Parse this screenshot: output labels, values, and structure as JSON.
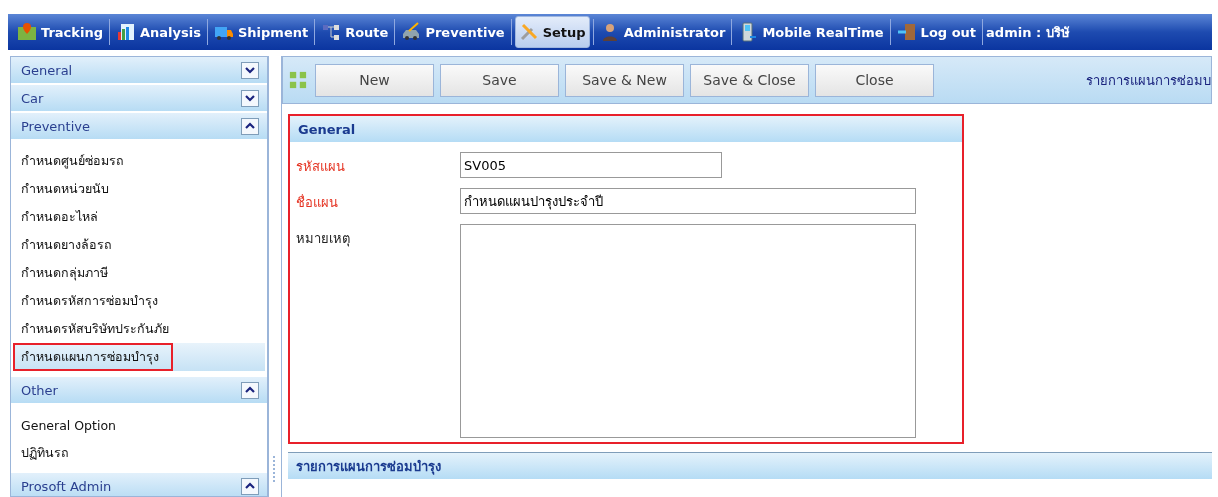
{
  "menu": [
    {
      "label": "Tracking",
      "selected": false
    },
    {
      "label": "Analysis",
      "selected": false
    },
    {
      "label": "Shipment",
      "selected": false
    },
    {
      "label": "Route",
      "selected": false
    },
    {
      "label": "Preventive",
      "selected": false
    },
    {
      "label": "Setup",
      "selected": true
    },
    {
      "label": "Administrator",
      "selected": false
    },
    {
      "label": "Mobile RealTime",
      "selected": false
    },
    {
      "label": "Log out",
      "selected": false
    }
  ],
  "user": "admin : บริษั",
  "sidebar": [
    {
      "title": "General",
      "expanded": false
    },
    {
      "title": "Car",
      "expanded": false
    },
    {
      "title": "Preventive",
      "expanded": true,
      "items": [
        {
          "label": "กำหนดศูนย์ซ่อมรถ",
          "selected": false
        },
        {
          "label": "กำหนดหน่วยนับ",
          "selected": false
        },
        {
          "label": "กำหนดอะไหล่",
          "selected": false
        },
        {
          "label": "กำหนดยางล้อรถ",
          "selected": false
        },
        {
          "label": "กำหนดกลุ่มภาษี",
          "selected": false
        },
        {
          "label": "กำหนดรหัสการซ่อมบำรุง",
          "selected": false
        },
        {
          "label": "กำหนดรหัสบริษัทประกันภัย",
          "selected": false
        },
        {
          "label": "กำหนดแผนการซ่อมบำรุง",
          "selected": true
        }
      ]
    },
    {
      "title": "Other",
      "expanded": true,
      "items": [
        {
          "label": "General Option",
          "selected": false
        },
        {
          "label": "ปฏิทินรถ",
          "selected": false
        }
      ]
    },
    {
      "title": "Prosoft Admin",
      "expanded": true
    }
  ],
  "toolbar": {
    "buttons": [
      "New",
      "Save",
      "Save & New",
      "Save & Close",
      "Close"
    ],
    "title": "รายการแผนการซ่อมบ"
  },
  "form": {
    "title": "General",
    "highlighted": true,
    "fields": [
      {
        "label": "รหัสแผน",
        "required": true,
        "kind": "short",
        "value": "SV005"
      },
      {
        "label": "ชื่อแผน",
        "required": true,
        "kind": "long",
        "value": "กำหนดแผนปารุงประจำปี"
      },
      {
        "label": "หมายเหตุ",
        "required": false,
        "kind": "multiline"
      }
    ]
  },
  "list_section": {
    "title": "รายการแผนการซ่อมบำรุง"
  }
}
